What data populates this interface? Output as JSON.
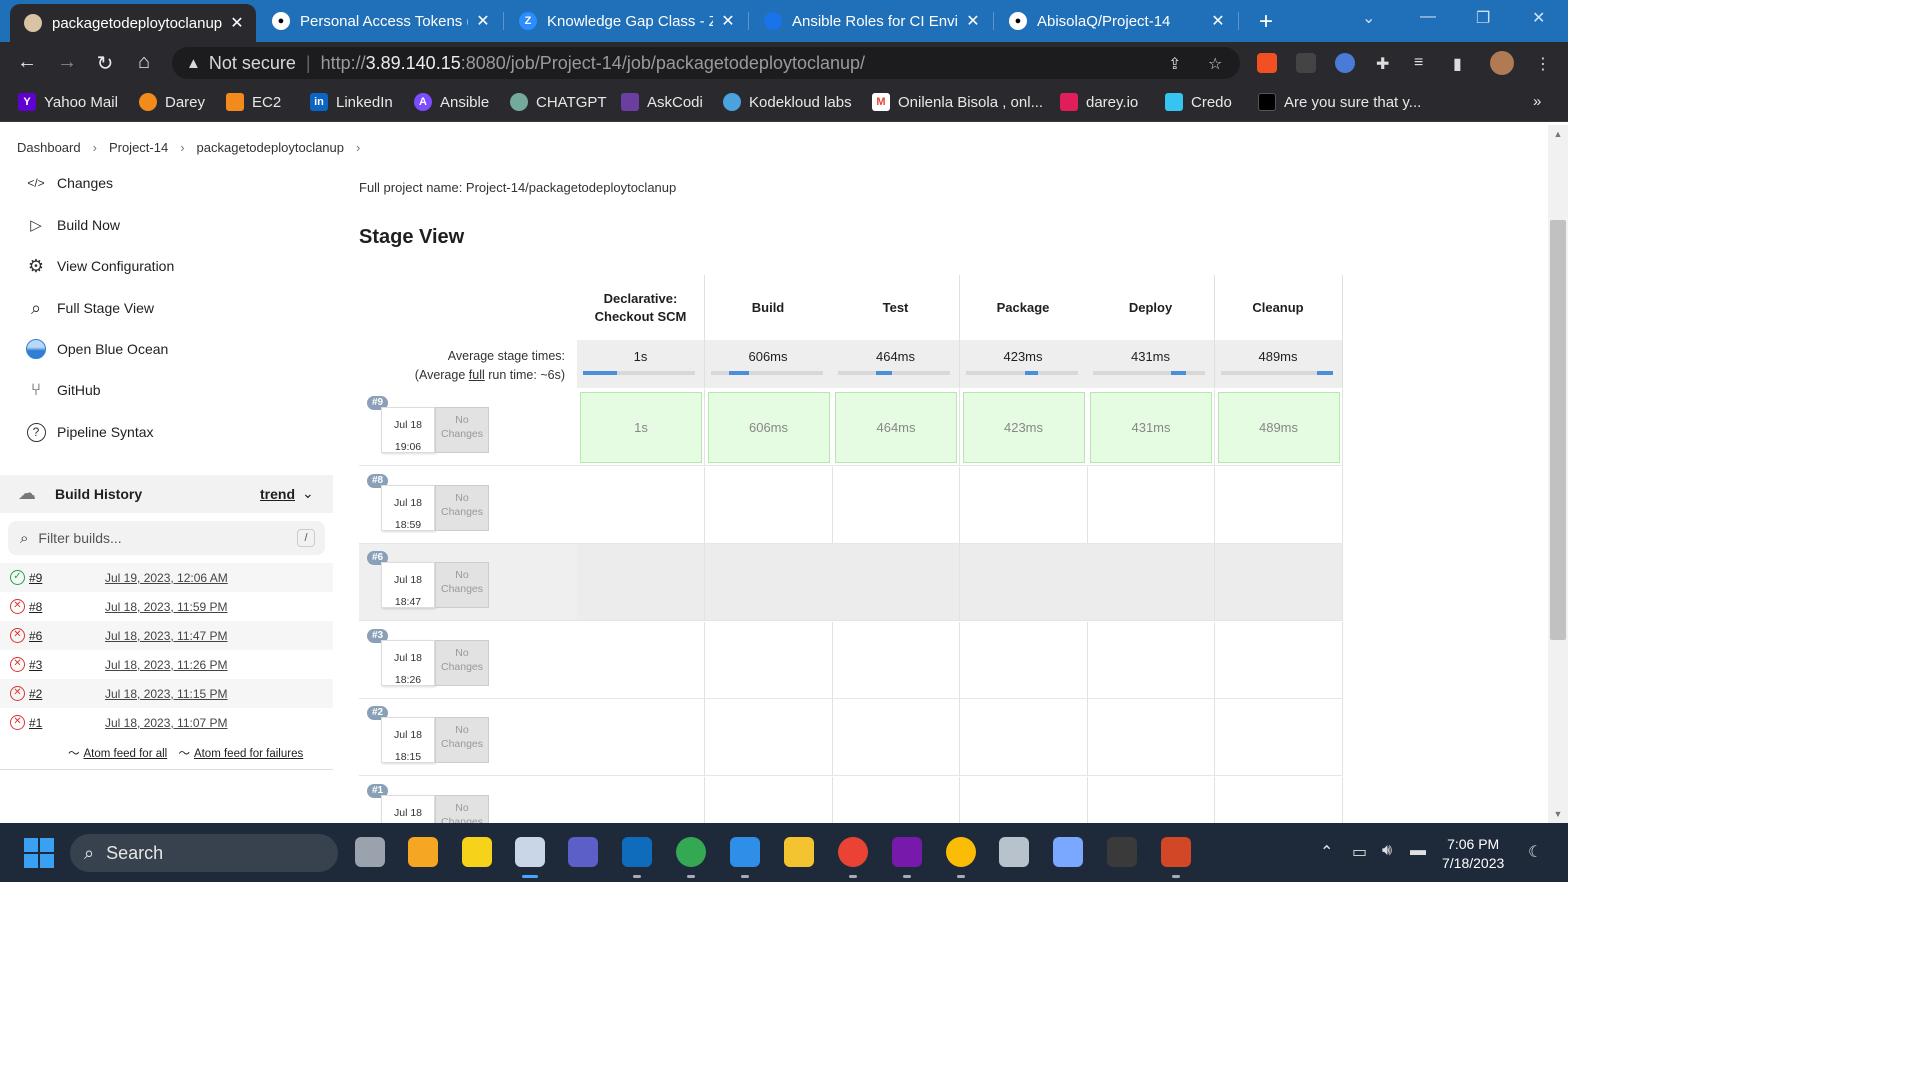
{
  "browser": {
    "tabs": [
      {
        "title": "packagetodeploytoclanup",
        "fav_color": "#d8c3a5",
        "fav_glyph": "",
        "icon": "jenkins-icon"
      },
      {
        "title": "Personal Access Tokens (C",
        "fav_color": "#ffffff",
        "fav_glyph": "",
        "icon": "github-icon"
      },
      {
        "title": "Knowledge Gap Class - Zo",
        "fav_color": "#2d8cff",
        "fav_glyph": "Z",
        "icon": "zoom-icon"
      },
      {
        "title": "Ansible Roles for CI Enviro",
        "fav_color": "#1a73e8",
        "fav_glyph": "",
        "icon": "confluence-icon"
      },
      {
        "title": "AbisolaQ/Project-14",
        "fav_color": "#ffffff",
        "fav_glyph": "",
        "icon": "github-icon"
      }
    ],
    "omnibox": {
      "security_label": "Not secure",
      "url_prefix": "http://",
      "url_host": "3.89.140.15",
      "url_rest": ":8080/job/Project-14/job/packagetodeploytoclanup/"
    },
    "bookmarks": [
      {
        "label": "Yahoo Mail",
        "color": "#6001d2",
        "glyph": "Y"
      },
      {
        "label": "Darey",
        "color": "#f28b1c",
        "glyph": ""
      },
      {
        "label": "EC2",
        "color": "#f28b1c",
        "glyph": ""
      },
      {
        "label": "LinkedIn",
        "color": "#0a66c2",
        "glyph": "in"
      },
      {
        "label": "Ansible",
        "color": "#7c4dff",
        "glyph": "A"
      },
      {
        "label": "CHATGPT",
        "color": "#74aa9c",
        "glyph": ""
      },
      {
        "label": "AskCodi",
        "color": "#6b3fa0",
        "glyph": ""
      },
      {
        "label": "Kodekloud labs",
        "color": "#4aa3df",
        "glyph": ""
      },
      {
        "label": "Onilenla Bisola , onl...",
        "color": "#ea4335",
        "glyph": "M"
      },
      {
        "label": "darey.io",
        "color": "#e01e5a",
        "glyph": ""
      },
      {
        "label": "Credo",
        "color": "#e01e5a",
        "glyph": ""
      },
      {
        "label": "Are you sure that y...",
        "color": "#000000",
        "glyph": ""
      }
    ],
    "bookmarks_overflow": "»"
  },
  "breadcrumb": [
    "Dashboard",
    "Project-14",
    "packagetodeploytoclanup"
  ],
  "sidebar": {
    "items": [
      {
        "label": "Changes",
        "glyph": "</>",
        "icon": "code-icon"
      },
      {
        "label": "Build Now",
        "glyph": "▷",
        "icon": "play-icon"
      },
      {
        "label": "View Configuration",
        "glyph": "⚙",
        "icon": "gear-icon"
      },
      {
        "label": "Full Stage View",
        "glyph": "⌕",
        "icon": "magnifier-icon"
      },
      {
        "label": "Open Blue Ocean",
        "glyph": "",
        "icon": "blue-ocean-icon"
      },
      {
        "label": "GitHub",
        "glyph": "⑂",
        "icon": "branch-icon"
      },
      {
        "label": "Pipeline Syntax",
        "glyph": "?",
        "icon": "help-icon"
      }
    ]
  },
  "build_history": {
    "title": "Build History",
    "trend_label": "trend",
    "filter_placeholder": "Filter builds...",
    "filter_shortcut": "/",
    "rows": [
      {
        "num": "#9",
        "date": "Jul 19, 2023, 12:06 AM",
        "status": "success"
      },
      {
        "num": "#8",
        "date": "Jul 18, 2023, 11:59 PM",
        "status": "failed"
      },
      {
        "num": "#6",
        "date": "Jul 18, 2023, 11:47 PM",
        "status": "failed"
      },
      {
        "num": "#3",
        "date": "Jul 18, 2023, 11:26 PM",
        "status": "failed"
      },
      {
        "num": "#2",
        "date": "Jul 18, 2023, 11:15 PM",
        "status": "failed"
      },
      {
        "num": "#1",
        "date": "Jul 18, 2023, 11:07 PM",
        "status": "failed"
      }
    ],
    "atom_all": "Atom feed for all",
    "atom_failures": "Atom feed for failures"
  },
  "main": {
    "full_project_name": "Full project name: Project-14/packagetodeploytoclanup",
    "stage_view_title": "Stage View",
    "avg_label_line1": "Average stage times:",
    "avg_label_line2_pre": "(Average ",
    "avg_label_full": "full",
    "avg_label_line2_post": " run time: ~6s)",
    "stages": [
      {
        "name_line1": "Declarative:",
        "name_line2": "Checkout SCM",
        "avg": "1s",
        "bar_fraction": 0.3
      },
      {
        "name_line1": "Build",
        "name_line2": "",
        "avg": "606ms",
        "bar_fraction": 0.18
      },
      {
        "name_line1": "Test",
        "name_line2": "",
        "avg": "464ms",
        "bar_fraction": 0.14
      },
      {
        "name_line1": "Package",
        "name_line2": "",
        "avg": "423ms",
        "bar_fraction": 0.12
      },
      {
        "name_line1": "Deploy",
        "name_line2": "",
        "avg": "431ms",
        "bar_fraction": 0.13
      },
      {
        "name_line1": "Cleanup",
        "name_line2": "",
        "avg": "489ms",
        "bar_fraction": 0.14
      }
    ],
    "runs": [
      {
        "badge": "#9",
        "date": "Jul 18",
        "time": "19:06",
        "changes": "No Changes",
        "status": "success",
        "durations": [
          "1s",
          "606ms",
          "464ms",
          "423ms",
          "431ms",
          "489ms"
        ]
      },
      {
        "badge": "#8",
        "date": "Jul 18",
        "time": "18:59",
        "changes": "No Changes",
        "status": "none",
        "durations": []
      },
      {
        "badge": "#6",
        "date": "Jul 18",
        "time": "18:47",
        "changes": "No Changes",
        "status": "none",
        "durations": []
      },
      {
        "badge": "#3",
        "date": "Jul 18",
        "time": "18:26",
        "changes": "No Changes",
        "status": "none",
        "durations": []
      },
      {
        "badge": "#2",
        "date": "Jul 18",
        "time": "18:15",
        "changes": "No Changes",
        "status": "none",
        "durations": []
      },
      {
        "badge": "#1",
        "date": "Jul 18",
        "time": "",
        "changes": "No Changes",
        "status": "none",
        "durations": []
      }
    ]
  },
  "taskbar": {
    "search_label": "Search",
    "time": "7:06 PM",
    "date": "7/18/2023",
    "apps": [
      {
        "icon": "task-view-icon",
        "color": "#9aa3ad"
      },
      {
        "icon": "weather-icon",
        "color": "#f5a623"
      },
      {
        "icon": "sticky-notes-icon",
        "color": "#f7d21b"
      },
      {
        "icon": "snipping-tool-icon",
        "color": "#c9d6e8"
      },
      {
        "icon": "teams-icon",
        "color": "#5b5fc7"
      },
      {
        "icon": "outlook-icon",
        "color": "#0f6cbd"
      },
      {
        "icon": "chrome-icon",
        "color": "#34a853"
      },
      {
        "icon": "vscode-icon",
        "color": "#2f8fe8"
      },
      {
        "icon": "file-explorer-icon",
        "color": "#f4c430"
      },
      {
        "icon": "chrome-profile-icon",
        "color": "#ea4335"
      },
      {
        "icon": "onenote-icon",
        "color": "#7719aa"
      },
      {
        "icon": "chrome-profile2-icon",
        "color": "#fbbc05"
      },
      {
        "icon": "virtualbox-icon",
        "color": "#b8c2cc"
      },
      {
        "icon": "vpn-icon",
        "color": "#7aa7ff"
      },
      {
        "icon": "terminal-icon",
        "color": "#3a3a3a"
      },
      {
        "icon": "powerpoint-icon",
        "color": "#d24726"
      }
    ]
  }
}
